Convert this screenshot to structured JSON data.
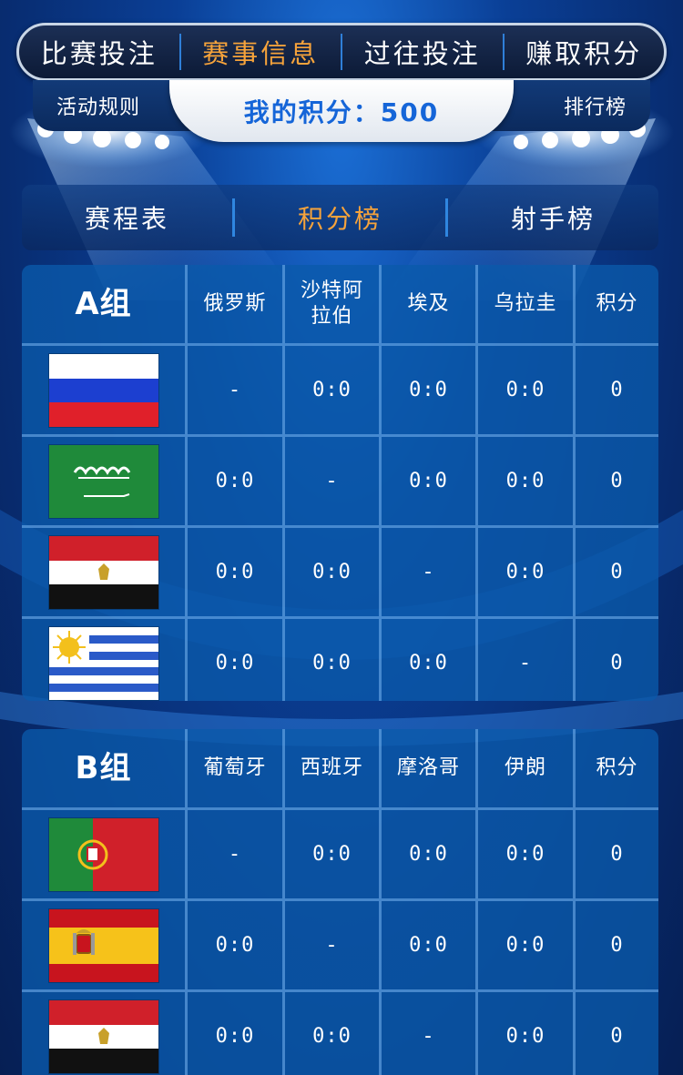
{
  "top_nav": {
    "tabs": [
      {
        "label": "比赛投注",
        "active": false
      },
      {
        "label": "赛事信息",
        "active": true
      },
      {
        "label": "过往投注",
        "active": false
      },
      {
        "label": "赚取积分",
        "active": false
      }
    ]
  },
  "sub_bar": {
    "rules_label": "活动规则",
    "points_text": "我的积分：500",
    "ranking_label": "排行榜"
  },
  "section_tabs": [
    {
      "label": "赛程表",
      "active": false
    },
    {
      "label": "积分榜",
      "active": true
    },
    {
      "label": "射手榜",
      "active": false
    }
  ],
  "groups": [
    {
      "title": "A组",
      "headers": [
        "俄罗斯",
        "沙特阿拉伯",
        "埃及",
        "乌拉圭",
        "积分"
      ],
      "rows": [
        {
          "flag": "russia",
          "cells": [
            "-",
            "0:0",
            "0:0",
            "0:0",
            "0"
          ]
        },
        {
          "flag": "saudi-arabia",
          "cells": [
            "0:0",
            "-",
            "0:0",
            "0:0",
            "0"
          ]
        },
        {
          "flag": "egypt",
          "cells": [
            "0:0",
            "0:0",
            "-",
            "0:0",
            "0"
          ]
        },
        {
          "flag": "uruguay",
          "cells": [
            "0:0",
            "0:0",
            "0:0",
            "-",
            "0"
          ]
        }
      ]
    },
    {
      "title": "B组",
      "headers": [
        "葡萄牙",
        "西班牙",
        "摩洛哥",
        "伊朗",
        "积分"
      ],
      "rows": [
        {
          "flag": "portugal",
          "cells": [
            "-",
            "0:0",
            "0:0",
            "0:0",
            "0"
          ]
        },
        {
          "flag": "spain",
          "cells": [
            "0:0",
            "-",
            "0:0",
            "0:0",
            "0"
          ]
        },
        {
          "flag": "egypt",
          "cells": [
            "0:0",
            "0:0",
            "-",
            "0:0",
            "0"
          ]
        }
      ]
    }
  ],
  "colors": {
    "accent": "#f6a33b",
    "points_text": "#1565d8"
  }
}
